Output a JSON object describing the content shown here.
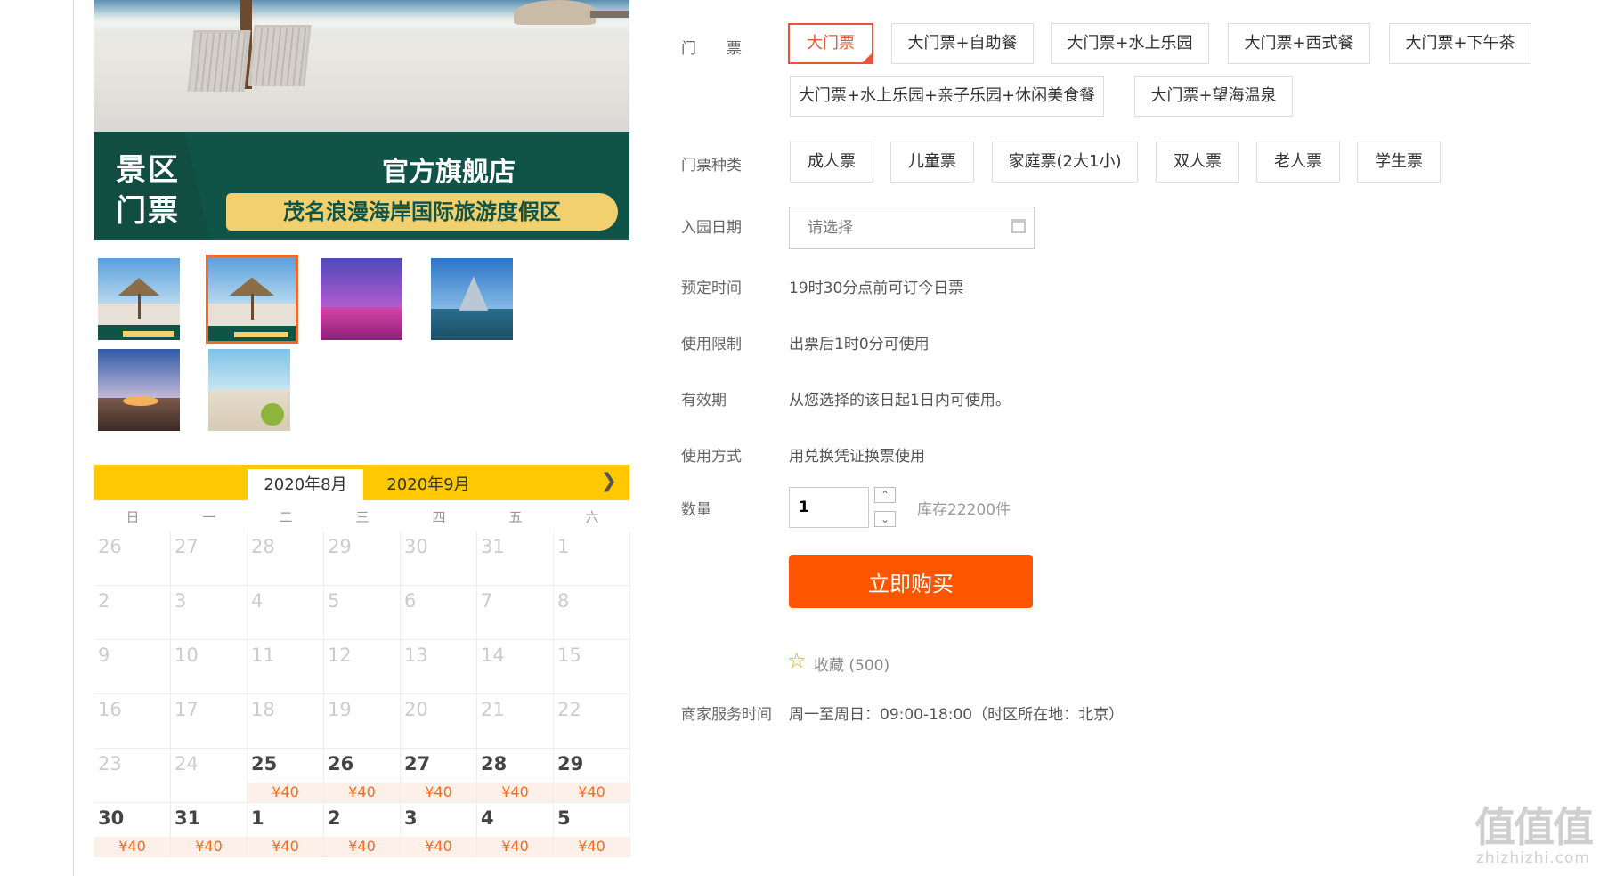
{
  "gallery": {
    "banner_left": [
      "景区",
      "门票"
    ],
    "banner_title": "官方旗舰店",
    "banner_subtitle": "茂名浪漫海岸国际旅游度假区",
    "thumbnails": [
      "beach-umbrella",
      "beach-umbrella",
      "pink-lights",
      "glass-pyramid",
      "sunset-dinner",
      "beach-jump"
    ],
    "selected_thumbnail": 1
  },
  "calendar": {
    "months": [
      "2020年8月",
      "2020年9月"
    ],
    "next_icon": "chevron-right-icon",
    "weekdays": [
      "日",
      "一",
      "二",
      "三",
      "四",
      "五",
      "六"
    ],
    "weeks": [
      [
        "26",
        "27",
        "28",
        "29",
        "30",
        "31",
        "1"
      ],
      [
        "2",
        "3",
        "4",
        "5",
        "6",
        "7",
        "8"
      ],
      [
        "9",
        "10",
        "11",
        "12",
        "13",
        "14",
        "15"
      ],
      [
        "16",
        "17",
        "18",
        "19",
        "20",
        "21",
        "22"
      ],
      [
        "23",
        "24",
        "25",
        "26",
        "27",
        "28",
        "29"
      ],
      [
        "30",
        "31",
        "1",
        "2",
        "3",
        "4",
        "5"
      ]
    ],
    "price": "¥40",
    "available_from": [
      4,
      2
    ]
  },
  "ticket": {
    "label": "门　　票",
    "options": [
      "大门票",
      "大门票+自助餐",
      "大门票+水上乐园",
      "大门票+西式餐",
      "大门票+下午茶",
      "大门票+水上乐园+亲子乐园+休闲美食餐",
      "大门票+望海温泉"
    ],
    "selected": 0
  },
  "ticket_type": {
    "label": "门票种类",
    "options": [
      "成人票",
      "儿童票",
      "家庭票(2大1小)",
      "双人票",
      "老人票",
      "学生票"
    ]
  },
  "entry_date": {
    "label": "入园日期",
    "placeholder": "请选择"
  },
  "booking_time": {
    "label": "预定时间",
    "value": "19时30分点前可订今日票"
  },
  "usage_limit": {
    "label": "使用限制",
    "value": "出票后1时0分可使用"
  },
  "validity": {
    "label": "有效期",
    "value": "从您选择的该日起1日内可使用。"
  },
  "usage_method": {
    "label": "使用方式",
    "value": "用兑换凭证换票使用"
  },
  "quantity": {
    "label": "数量",
    "value": "1",
    "stock": "库存22200件"
  },
  "buy_button": "立即购买",
  "favorite": {
    "icon": "star-icon",
    "text": "收藏 (500)"
  },
  "service_time": {
    "label": "商家服务时间",
    "value": "周一至周日：09:00-18:00（时区所在地：北京）"
  },
  "watermark": {
    "logo": "值值值",
    "url": "zhizhizhi.com"
  },
  "colors": {
    "accent": "#fe5500",
    "selected_border": "#e8533a",
    "calendar_header": "#ffc800",
    "banner_green": "#0f5447",
    "price": "#f36a1d"
  }
}
